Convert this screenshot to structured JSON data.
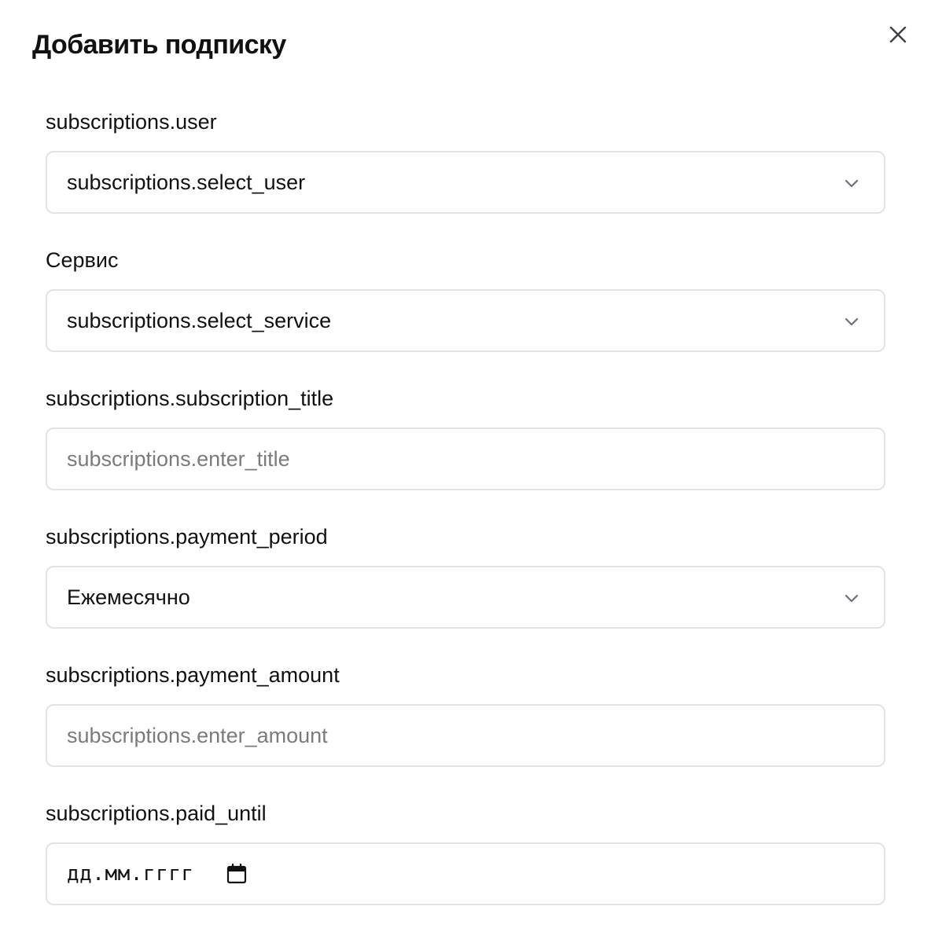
{
  "dialog": {
    "title": "Добавить подписку",
    "close_icon": "close-icon"
  },
  "fields": {
    "user": {
      "label": "subscriptions.user",
      "value": "subscriptions.select_user",
      "icon": "chevron-down-icon"
    },
    "service": {
      "label": "Сервис",
      "value": "subscriptions.select_service",
      "icon": "chevron-down-icon"
    },
    "title": {
      "label": "subscriptions.subscription_title",
      "placeholder": "subscriptions.enter_title"
    },
    "payment_period": {
      "label": "subscriptions.payment_period",
      "value": "Ежемесячно",
      "icon": "chevron-down-icon"
    },
    "payment_amount": {
      "label": "subscriptions.payment_amount",
      "placeholder": "subscriptions.enter_amount"
    },
    "paid_until": {
      "label": "subscriptions.paid_until",
      "placeholder": "дд.мм.гггг",
      "icon": "calendar-icon"
    }
  },
  "colors": {
    "border": "#e4e4e7",
    "text": "#111111",
    "placeholder": "#7b7b7e",
    "icon": "#71717a"
  }
}
